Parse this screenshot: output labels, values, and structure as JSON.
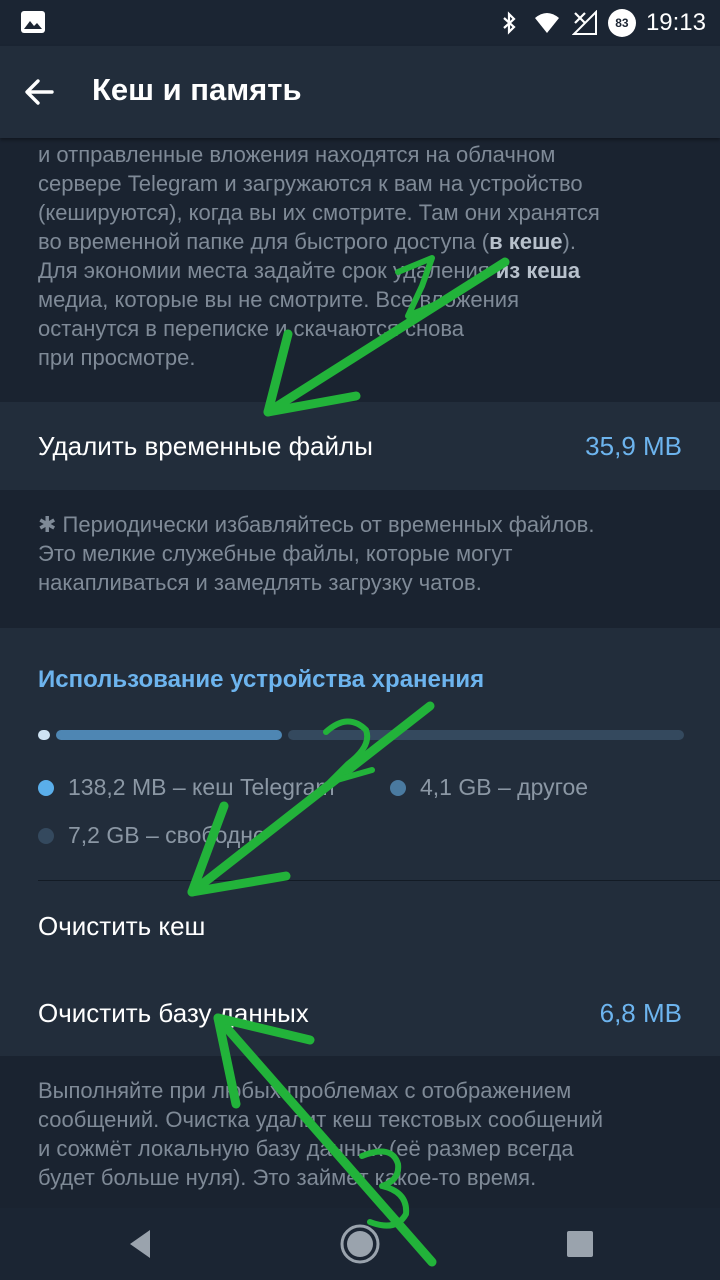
{
  "status_bar": {
    "time": "19:13",
    "battery_level": "83",
    "icons": [
      "image-icon",
      "bluetooth-icon",
      "wifi-icon",
      "no-signal-icon",
      "battery-icon"
    ]
  },
  "app_bar": {
    "title": "Кеш и память",
    "back_icon": "arrow-left-icon"
  },
  "cache_description": {
    "line1": "и отправленные вложения находятся на облачном",
    "line2": "сервере Telegram и загружаются к вам на устройство",
    "line3": "(кешируются), когда вы их смотрите. Там они хранятся",
    "line4_pre": "во временной папке для быстрого доступа (",
    "line4_bold": "в кеше",
    "line4_post": ").",
    "line5_pre": "Для экономии места задайте срок удаления ",
    "line5_bold": "из кеша",
    "line6": "медиа, которые вы не смотрите. Все вложения",
    "line7": "останутся в переписке и скачаются снова",
    "line8": "при просмотре."
  },
  "temp_files": {
    "label": "Удалить временные файлы",
    "value": "35,9 MB",
    "description_line1": "✱ Периодически избавляйтесь от временных файлов.",
    "description_line2": "Это мелкие служебные файлы, которые могут",
    "description_line3": "накапливаться и замедлять загрузку чатов."
  },
  "storage": {
    "title": "Использование устройства хранения",
    "legend": [
      {
        "label": "138,2 MB – кеш Telegram",
        "color": "#5aaeea"
      },
      {
        "label": "4,1 GB – другое",
        "color": "#4a7aa0"
      },
      {
        "label": "7,2 GB – свободно",
        "color": "#34495e"
      }
    ],
    "usage_fractions": {
      "telegram": 0.012,
      "other": 0.356,
      "free": 0.632
    },
    "bar_colors": {
      "telegram": "#cfe3f3",
      "other": "#4e86b3",
      "free": "#34495e"
    }
  },
  "clear_cache": {
    "label": "Очистить кеш"
  },
  "clear_database": {
    "label": "Очистить базу данных",
    "value": "6,8 MB",
    "description_line1": "Выполняйте при любых проблемах с отображением",
    "description_line2": "сообщений. Очистка удалит кеш текстовых сообщений",
    "description_line3": "и сожмёт локальную базу данных (её размер всегда",
    "description_line4": "будет больше нуля). Это займёт какое-то время."
  },
  "annotations": {
    "color": "#22b33a",
    "numbers": [
      "1",
      "2",
      "3"
    ]
  },
  "nav_bar": {
    "icons": [
      "back-triangle-icon",
      "home-circle-icon",
      "recents-square-icon"
    ]
  }
}
